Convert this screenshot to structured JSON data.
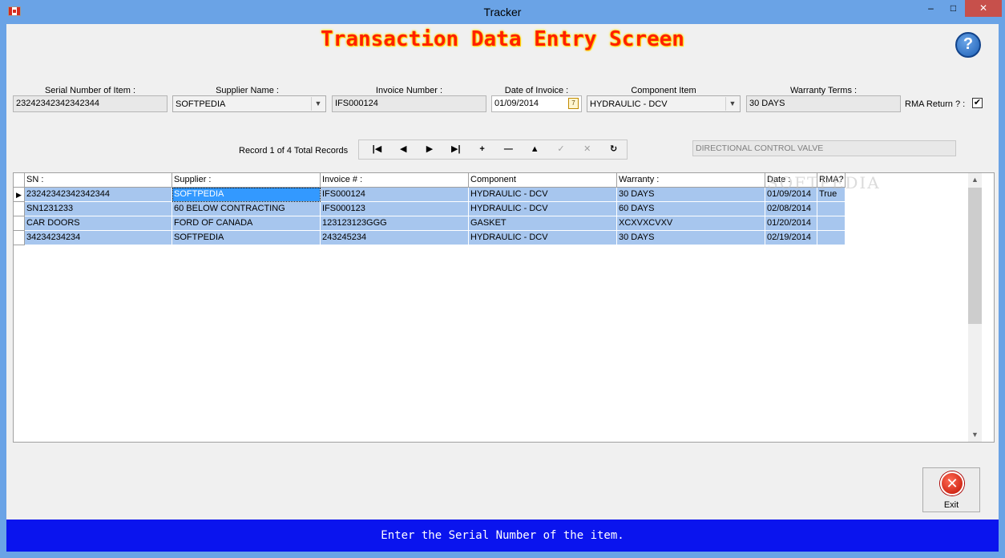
{
  "window": {
    "title": "Tracker",
    "minimize_glyph": "–",
    "maximize_glyph": "□",
    "close_glyph": "✕",
    "icon": "canada-flag-icon"
  },
  "page": {
    "title": "Transaction Data Entry Screen",
    "help_glyph": "?"
  },
  "form": {
    "serial_label": "Serial Number of Item :",
    "serial_value": "23242342342342344",
    "supplier_label": "Supplier Name :",
    "supplier_value": "SOFTPEDIA",
    "invoice_label": "Invoice Number :",
    "invoice_value": "IFS000124",
    "date_label": "Date of Invoice :",
    "date_value": "01/09/2014",
    "component_label": "Component Item",
    "component_value": "HYDRAULIC - DCV",
    "warranty_label": "Warranty Terms :",
    "warranty_value": "30 DAYS",
    "rma_label": "RMA Return ? :",
    "rma_checked": "✔",
    "combo_arrow": "▼",
    "calendar_glyph": "7"
  },
  "navigator": {
    "record_text": "Record 1 of 4 Total Records",
    "buttons": [
      {
        "name": "first-record-button",
        "glyph": "|◀",
        "enabled": true
      },
      {
        "name": "previous-record-button",
        "glyph": "◀",
        "enabled": true
      },
      {
        "name": "next-record-button",
        "glyph": "▶",
        "enabled": true
      },
      {
        "name": "last-record-button",
        "glyph": "▶|",
        "enabled": true
      },
      {
        "name": "add-record-button",
        "glyph": "+",
        "enabled": true
      },
      {
        "name": "delete-record-button",
        "glyph": "—",
        "enabled": true
      },
      {
        "name": "edit-record-button",
        "glyph": "▲",
        "enabled": true
      },
      {
        "name": "post-edit-button",
        "glyph": "✓",
        "enabled": false
      },
      {
        "name": "cancel-edit-button",
        "glyph": "✕",
        "enabled": false
      },
      {
        "name": "refresh-data-button",
        "glyph": "↻",
        "enabled": true
      }
    ]
  },
  "description": "DIRECTIONAL CONTROL VALVE",
  "grid": {
    "columns": [
      "SN :",
      "Supplier :",
      "Invoice # :",
      "Component",
      "Warranty :",
      "Date :",
      "RMA?"
    ],
    "rows": [
      [
        "23242342342342344",
        "SOFTPEDIA",
        "IFS000124",
        "HYDRAULIC - DCV",
        "30 DAYS",
        "01/09/2014",
        "True"
      ],
      [
        "SN1231233",
        "60 BELOW CONTRACTING",
        "IFS000123",
        "HYDRAULIC - DCV",
        "60 DAYS",
        "02/08/2014",
        ""
      ],
      [
        "CAR DOORS",
        "FORD OF CANADA",
        "123123123GGG",
        "GASKET",
        "XCXVXCVXV",
        "01/20/2014",
        ""
      ],
      [
        "34234234234",
        "SOFTPEDIA",
        "243245234",
        "HYDRAULIC - DCV",
        "30 DAYS",
        "02/19/2014",
        ""
      ]
    ],
    "current_row_glyph": "▶",
    "watermark": "SOFTPEDIA",
    "scroll_up_glyph": "▲",
    "scroll_down_glyph": "▼"
  },
  "exit": {
    "label": "Exit",
    "glyph": "✕"
  },
  "status": "Enter the Serial Number of the item.",
  "colors": {
    "title_red": "#ff2000",
    "status_blue": "#0a14ee",
    "row_highlight": "#a7c6ee",
    "window_frame": "#6aa3e6"
  }
}
